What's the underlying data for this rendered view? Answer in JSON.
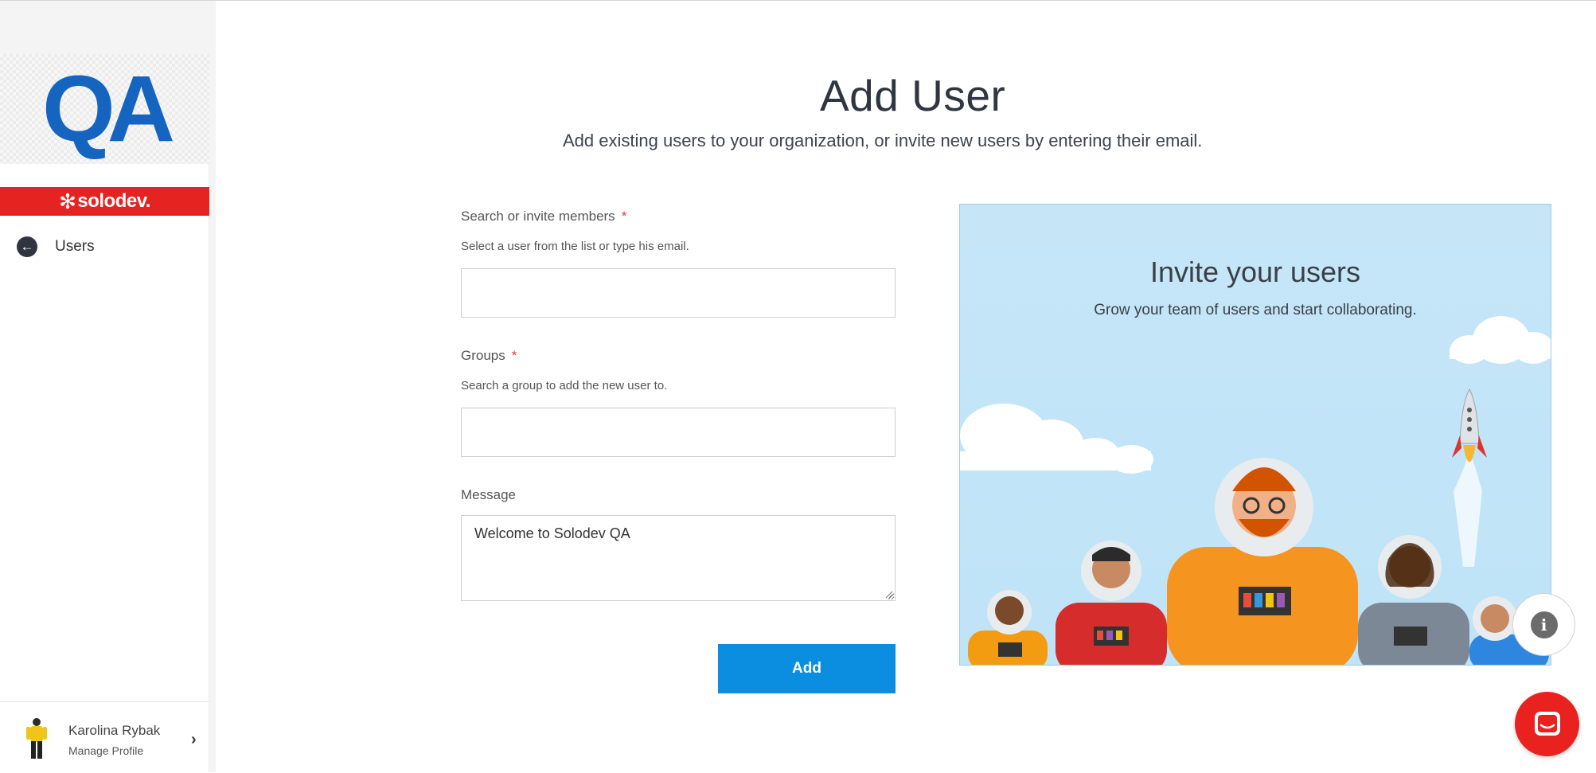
{
  "sidebar": {
    "logo_text": "QA",
    "brand_name": "solodev.",
    "nav": {
      "back_label": "Users"
    },
    "profile": {
      "name": "Karolina Rybak",
      "sub_label": "Manage Profile"
    }
  },
  "main": {
    "title": "Add User",
    "subtitle": "Add existing users to your organization, or invite new users by entering their email.",
    "form": {
      "members": {
        "label": "Search or invite members",
        "required_mark": "*",
        "help": "Select a user from the list or type his email.",
        "value": ""
      },
      "groups": {
        "label": "Groups",
        "required_mark": "*",
        "help": "Search a group to add the new user to.",
        "value": ""
      },
      "message": {
        "label": "Message",
        "value": "Welcome to Solodev QA"
      },
      "submit_label": "Add"
    },
    "panel": {
      "title": "Invite your users",
      "subtitle": "Grow your team of users and start collaborating."
    }
  },
  "widgets": {
    "info_icon": "info-icon",
    "chat_icon": "chat-icon"
  },
  "colors": {
    "brand_red": "#e52320",
    "logo_blue": "#1565c0",
    "primary_button": "#0b8ee0",
    "panel_sky": "#c6e6f8"
  }
}
